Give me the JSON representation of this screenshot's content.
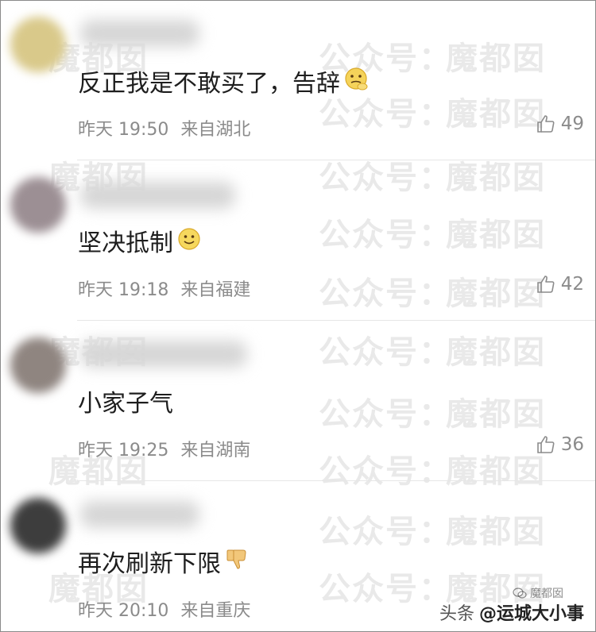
{
  "watermark": {
    "text_account": "公众号：",
    "text_name": "魔都囡"
  },
  "comments": [
    {
      "content": "反正我是不敢买了，告辞",
      "emoji": "thinking-face-icon",
      "date": "昨天 19:50",
      "location": "来自湖北",
      "likes": "49",
      "avatar_color": "#d9c98a"
    },
    {
      "content": "坚决抵制",
      "emoji": "smiling-face-icon",
      "date": "昨天 19:18",
      "location": "来自福建",
      "likes": "42",
      "avatar_color": "#9c8f94"
    },
    {
      "content": "小家子气",
      "emoji": "",
      "date": "昨天 19:25",
      "location": "来自湖南",
      "likes": "36",
      "avatar_color": "#8f8580"
    },
    {
      "content": "再次刷新下限",
      "emoji": "thumbs-down-icon",
      "date": "昨天 20:10",
      "location": "来自重庆",
      "likes": "",
      "avatar_color": "#3d3d3d"
    }
  ],
  "footer": {
    "source": "头条",
    "handle": "@运城大小事",
    "faint": "魔都囡"
  }
}
